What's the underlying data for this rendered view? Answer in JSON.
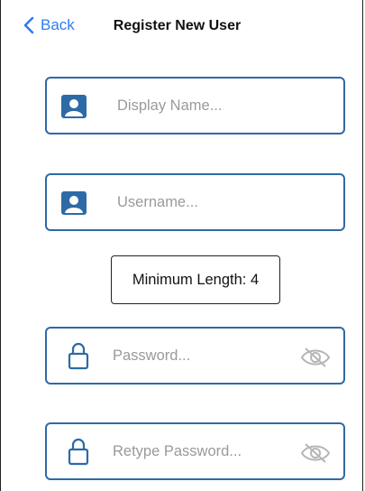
{
  "nav": {
    "back_label": "Back",
    "title": "Register New User"
  },
  "fields": {
    "display_name": {
      "placeholder": "Display Name...",
      "icon": "person-icon"
    },
    "username": {
      "placeholder": "Username...",
      "icon": "person-icon"
    },
    "password": {
      "placeholder": "Password...",
      "icon": "lock-icon",
      "toggle_icon": "eye-slash-icon"
    },
    "retype_password": {
      "placeholder": "Retype Password...",
      "icon": "lock-icon",
      "toggle_icon": "eye-slash-icon"
    }
  },
  "hint": {
    "min_length": "Minimum Length: 4"
  },
  "colors": {
    "accent": "#2f7cf6",
    "field_border": "#2e6aa5",
    "icon_blue": "#2e6aa5",
    "placeholder": "#9a9a9a"
  }
}
